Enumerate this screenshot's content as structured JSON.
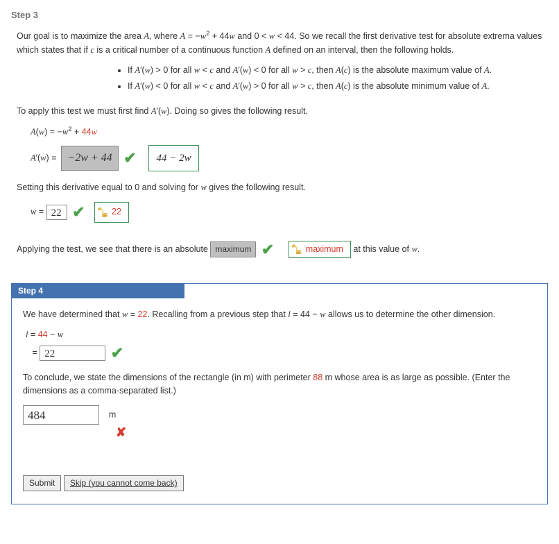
{
  "step3": {
    "title": "Step 3",
    "intro_html": "Our goal is to maximize the area <span class='math-var'>A</span>, where <span class='math-var'>A</span> = −<span class='math-var'>w</span><sup>2</sup> + 44<span class='math-var'>w</span> and 0 &lt; <span class='math-var'>w</span> &lt; 44. So we recall the first derivative test for absolute extrema values which states that if <span class='math-var'>c</span> is a critical number of a continuous function <span class='math-var'>A</span> defined on an interval, then the following holds.",
    "bullet1_html": "If <span class='math-var'>A</span>&#x2032;(<span class='math-var'>w</span>) &gt; 0 for all <span class='math-var'>w</span> &lt; <span class='math-var'>c</span> and <span class='math-var'>A</span>&#x2032;(<span class='math-var'>w</span>) &lt; 0 for all <span class='math-var'>w</span> &gt; <span class='math-var'>c</span>, then <span class='math-var'>A</span>(<span class='math-var'>c</span>) is the absolute maximum value of <span class='math-var'>A</span>.",
    "bullet2_html": "If <span class='math-var'>A</span>&#x2032;(<span class='math-var'>w</span>) &lt; 0 for all <span class='math-var'>w</span> &lt; <span class='math-var'>c</span> and <span class='math-var'>A</span>&#x2032;(<span class='math-var'>w</span>) &gt; 0 for all <span class='math-var'>w</span> &gt; <span class='math-var'>c</span>, then <span class='math-var'>A</span>(<span class='math-var'>c</span>) is the absolute minimum value of <span class='math-var'>A</span>.",
    "apply_line_html": "To apply this test we must first find <span class='math-var'>A</span>&#x2032;(<span class='math-var'>w</span>). Doing so gives the following result.",
    "eqA_lhs_html": "<span class='math-var'>A</span>(<span class='math-var'>w</span>)",
    "eqA_rhs_html": "−<span class='math-var'>w</span><sup>2</sup> + <span class='red'>44<span class='math-var'>w</span></span>",
    "eqAprime_lhs_html": "<span class='math-var'>A</span>&#x2032;(<span class='math-var'>w</span>)",
    "user_deriv": "−2w + 44",
    "correct_deriv": "44 − 2w",
    "setting_line_html": "Setting this derivative equal to 0 and solving for <span class='math-var'>w</span> gives the following result.",
    "w_eq": "w =",
    "w_user": "22",
    "w_correct": "22",
    "apply_test_pre": "Applying the test, we see that there is an absolute",
    "ext_user": "maximum",
    "ext_correct": "maximum",
    "apply_test_post_html": " at this value of <span class='math-var'>w</span>."
  },
  "step4": {
    "title": "Step 4",
    "intro_html": "We have determined that <span class='math-var'>w</span> = <span class='red'>22</span>. Recalling from a previous step that <span class='math-var'>l</span> = 44 − <span class='math-var'>w</span> allows us to determine the other dimension.",
    "l_line1_html": "<span class='math-var'>l</span> = <span class='red'>44</span> − <span class='math-var'>w</span>",
    "eq_sign": "=",
    "l_user": "22",
    "conclude_html": "To conclude, we state the dimensions of the rectangle (in m) with perimeter <span class='red'>88</span> m whose area is as large as possible. (Enter the dimensions as a comma-separated list.)",
    "dims_user": "484",
    "unit": "m",
    "submit_label": "Submit",
    "skip_label": "Skip (you cannot come back)"
  }
}
